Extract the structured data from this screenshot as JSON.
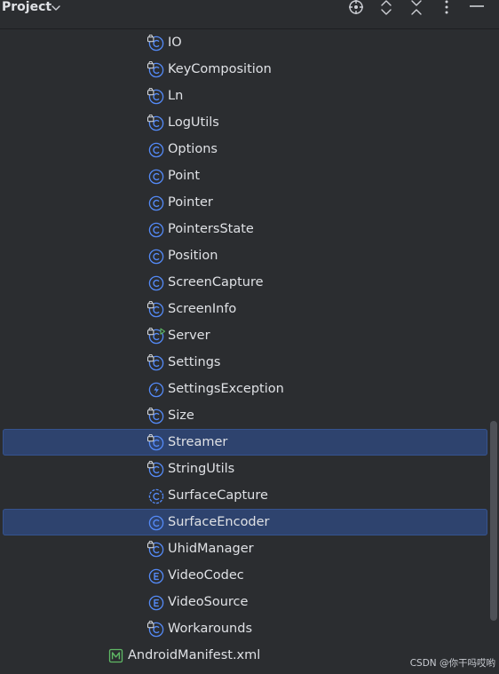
{
  "header": {
    "title": "Project",
    "dropdown_icon": "chevron-down-icon",
    "actions": [
      "locate-icon",
      "expand-all-icon",
      "collapse-all-icon",
      "more-options-icon",
      "hide-panel-icon"
    ]
  },
  "colors": {
    "background": "#2b2d30",
    "selection": "#2e436e",
    "class_icon": "#548af7",
    "manifest_icon": "#5fb865",
    "text": "#dfe1e5"
  },
  "tree": {
    "items": [
      {
        "label": "IO",
        "icon": "class-icon",
        "icon_badge": "lock",
        "selected": false
      },
      {
        "label": "KeyComposition",
        "icon": "class-icon",
        "icon_badge": "lock",
        "selected": false
      },
      {
        "label": "Ln",
        "icon": "class-icon",
        "icon_badge": "lock",
        "selected": false
      },
      {
        "label": "LogUtils",
        "icon": "class-icon",
        "icon_badge": "lock",
        "selected": false
      },
      {
        "label": "Options",
        "icon": "class-icon",
        "icon_badge": "",
        "selected": false
      },
      {
        "label": "Point",
        "icon": "class-icon",
        "icon_badge": "",
        "selected": false
      },
      {
        "label": "Pointer",
        "icon": "class-icon",
        "icon_badge": "",
        "selected": false
      },
      {
        "label": "PointersState",
        "icon": "class-icon",
        "icon_badge": "",
        "selected": false
      },
      {
        "label": "Position",
        "icon": "class-icon",
        "icon_badge": "",
        "selected": false
      },
      {
        "label": "ScreenCapture",
        "icon": "class-icon",
        "icon_badge": "",
        "selected": false
      },
      {
        "label": "ScreenInfo",
        "icon": "class-icon",
        "icon_badge": "lock",
        "selected": false
      },
      {
        "label": "Server",
        "icon": "class-icon",
        "icon_badge": "lock-run",
        "selected": false
      },
      {
        "label": "Settings",
        "icon": "class-icon",
        "icon_badge": "lock",
        "selected": false
      },
      {
        "label": "SettingsException",
        "icon": "exception-class-icon",
        "icon_badge": "",
        "selected": false
      },
      {
        "label": "Size",
        "icon": "class-icon",
        "icon_badge": "lock",
        "selected": false
      },
      {
        "label": "Streamer",
        "icon": "class-icon",
        "icon_badge": "lock",
        "selected": true
      },
      {
        "label": "StringUtils",
        "icon": "class-icon",
        "icon_badge": "lock",
        "selected": false
      },
      {
        "label": "SurfaceCapture",
        "icon": "abstract-class-icon",
        "icon_badge": "",
        "selected": false
      },
      {
        "label": "SurfaceEncoder",
        "icon": "class-icon",
        "icon_badge": "",
        "selected": true
      },
      {
        "label": "UhidManager",
        "icon": "class-icon",
        "icon_badge": "lock",
        "selected": false
      },
      {
        "label": "VideoCodec",
        "icon": "enum-icon",
        "icon_badge": "",
        "selected": false
      },
      {
        "label": "VideoSource",
        "icon": "enum-icon",
        "icon_badge": "",
        "selected": false
      },
      {
        "label": "Workarounds",
        "icon": "class-icon",
        "icon_badge": "lock",
        "selected": false
      }
    ],
    "manifest": {
      "label": "AndroidManifest.xml",
      "icon": "manifest-icon"
    }
  },
  "watermark": "CSDN @你干吗哎哟"
}
